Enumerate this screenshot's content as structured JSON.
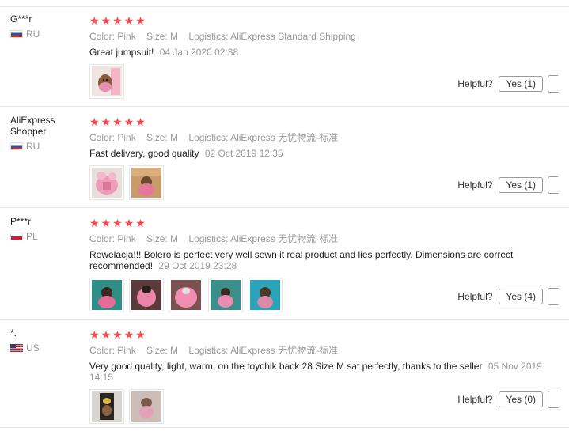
{
  "reviews": [
    {
      "user": "G***r",
      "country": "RU",
      "stars": [
        "★",
        "★",
        "★",
        "★",
        "★"
      ],
      "color": "Color: Pink",
      "size": "Size: M",
      "logistics": "Logistics: AliExpress Standard Shipping",
      "text": "Great jumpsuit!",
      "date": "04 Jan 2020 02:38",
      "helpful_label": "Helpful?",
      "yes_label": "Yes (1)"
    },
    {
      "user": "AliExpress Shopper",
      "country": "RU",
      "stars": [
        "★",
        "★",
        "★",
        "★",
        "★"
      ],
      "color": "Color: Pink",
      "size": "Size: M",
      "logistics": "Logistics: AliExpress 无忧物流-标准",
      "text": "Fast delivery, good quality",
      "date": "02 Oct 2019 12:35",
      "helpful_label": "Helpful?",
      "yes_label": "Yes (1)"
    },
    {
      "user": "P***r",
      "country": "PL",
      "stars": [
        "★",
        "★",
        "★",
        "★",
        "★"
      ],
      "color": "Color: Pink",
      "size": "Size: M",
      "logistics": "Logistics: AliExpress 无忧物流-标准",
      "text": "Rewelacja!!! Bolero is perfect very well sewn it real product and lies perfectly. Dimensions are correct recommended!",
      "date": "29 Oct 2019 23:28",
      "helpful_label": "Helpful?",
      "yes_label": "Yes (4)"
    },
    {
      "user": "*.",
      "country": "US",
      "stars": [
        "★",
        "★",
        "★",
        "★",
        "★"
      ],
      "color": "Color: Pink",
      "size": "Size: M",
      "logistics": "Logistics: AliExpress 无忧物流-标准",
      "text": "Very good quality, light, warm, on the toychik back 28 Size M sat perfectly, thanks to the seller",
      "date": "05 Nov 2019 14:15",
      "helpful_label": "Helpful?",
      "yes_label": "Yes (0)"
    }
  ],
  "colors": {
    "star": "#ff4747",
    "muted": "#999999",
    "text": "#222222"
  }
}
